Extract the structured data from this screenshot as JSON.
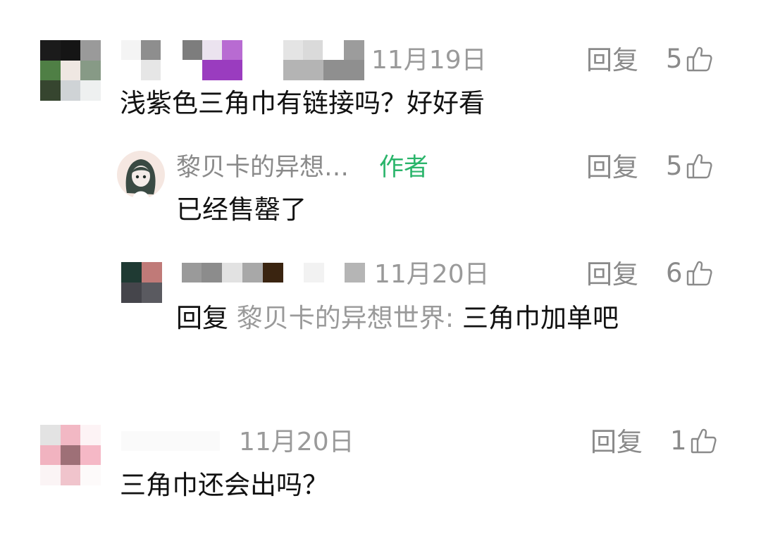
{
  "colors": {
    "author_badge": "#2bb56b",
    "meta_gray": "#8a8a8a",
    "text_dark": "#111111"
  },
  "icons": {
    "like": "thumbs-up-icon"
  },
  "comments": [
    {
      "date": "11月19日",
      "reply_label": "回复",
      "likes": "5",
      "text": "浅紫色三角巾有链接吗？好好看",
      "replies": [
        {
          "nickname": "黎贝卡的异想…",
          "badge": "作者",
          "reply_label": "回复",
          "likes": "5",
          "text": "已经售罄了"
        },
        {
          "date": "11月20日",
          "reply_label": "回复",
          "likes": "6",
          "text_prefix": "回复",
          "mention": "黎贝卡的异想世界:",
          "text": "三角巾加单吧"
        }
      ]
    },
    {
      "date": "11月20日",
      "reply_label": "回复",
      "likes": "1",
      "text": "三角巾还会出吗？"
    }
  ]
}
